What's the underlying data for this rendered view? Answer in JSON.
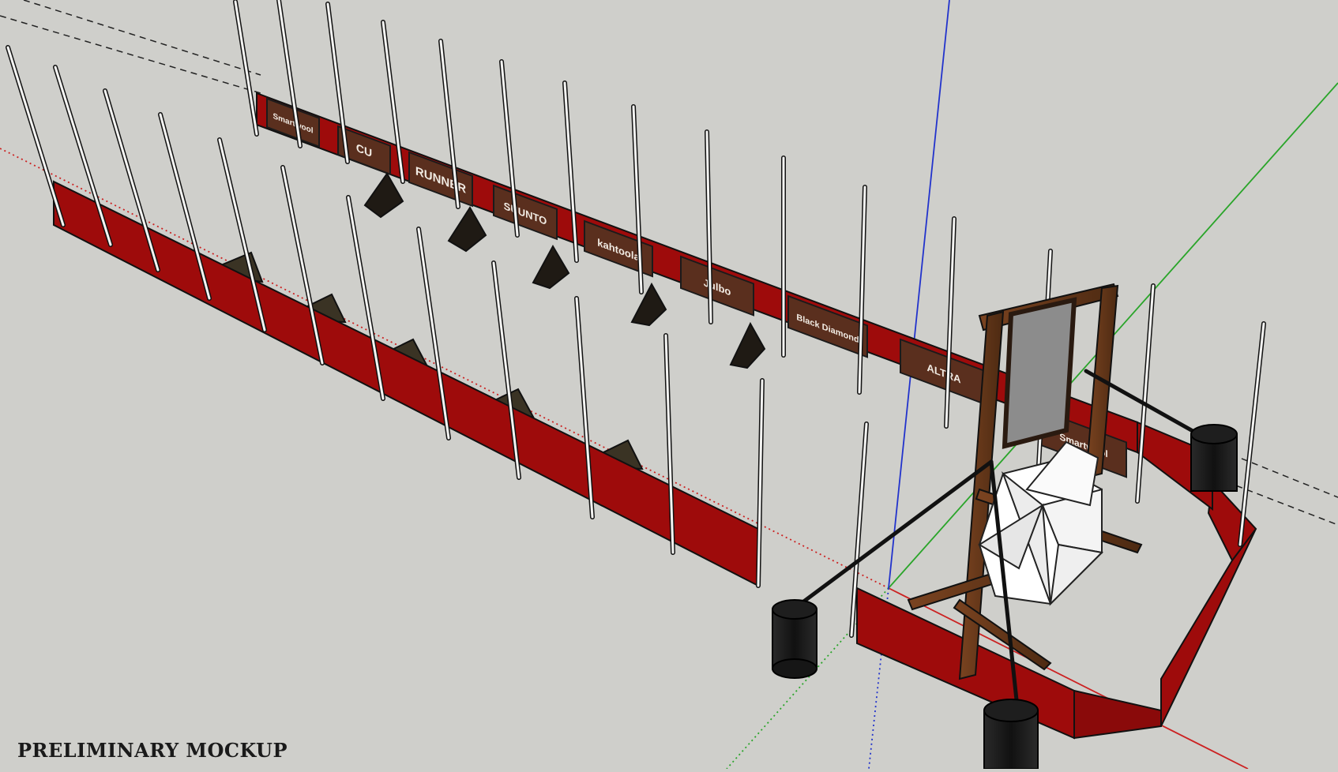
{
  "caption": "PRELIMINARY MOCKUP",
  "sponsor_banners": [
    {
      "label": "Smartwool",
      "icon": "smartwool-logo"
    },
    {
      "label": "CU",
      "icon": "cu-logo"
    },
    {
      "label": "RUNNER",
      "icon": "runner-logo"
    },
    {
      "label": "SUUNTO",
      "icon": "suunto-logo"
    },
    {
      "label": "kahtoola",
      "icon": "kahtoola-logo"
    },
    {
      "label": "Julbo",
      "icon": "julbo-logo"
    },
    {
      "label": "Black Diamond",
      "icon": "black-diamond-logo"
    },
    {
      "label": "ALTRA",
      "icon": "altra-logo"
    },
    {
      "label": "Smartwool",
      "icon": "smartwool-logo"
    }
  ],
  "colors": {
    "background": "#cfcfcb",
    "barrier_red": "#9e0b0b",
    "banner_brown": "#5a2f1e",
    "frame_wood": "#6b3a1a",
    "axis_red": "#cc2222",
    "axis_green": "#2aa52a",
    "axis_blue": "#2233cc"
  }
}
